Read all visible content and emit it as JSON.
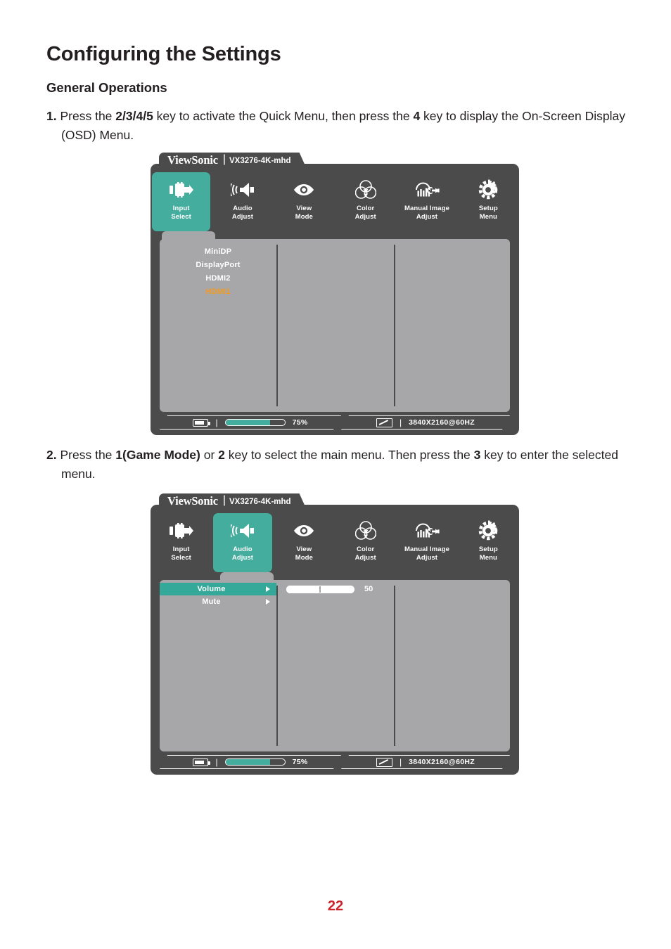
{
  "document": {
    "heading": "Configuring the Settings",
    "subheading": "General Operations",
    "page_number": "22"
  },
  "steps": [
    {
      "number": "1.",
      "parts": [
        {
          "t": "Press the ",
          "b": false
        },
        {
          "t": "2/3/4/5",
          "b": true
        },
        {
          "t": " key to activate the Quick Menu, then press the ",
          "b": false
        },
        {
          "t": "4",
          "b": true
        },
        {
          "t": " key to display the On-Screen Display (OSD) Menu.",
          "b": false
        }
      ]
    },
    {
      "number": "2.",
      "parts": [
        {
          "t": "Press the ",
          "b": false
        },
        {
          "t": "1(Game Mode)",
          "b": true
        },
        {
          "t": " or ",
          "b": false
        },
        {
          "t": "2",
          "b": true
        },
        {
          "t": " key to select the main menu. Then press the ",
          "b": false
        },
        {
          "t": "3",
          "b": true
        },
        {
          "t": " key to enter the selected menu.",
          "b": false
        }
      ]
    }
  ],
  "colors": {
    "accent_teal": "#45ad9e",
    "row_teal": "#34a99a",
    "frame_dark": "#4b4b4b",
    "panel_gray": "#a7a7a9",
    "selected_orange": "#f59a1f",
    "page_number_red": "#cc2229"
  },
  "osd_common": {
    "brand": "ViewSonic",
    "separator": "|",
    "model": "VX3276-4K-mhd",
    "menu_items": [
      {
        "label_line1": "Input",
        "label_line2": "Select",
        "icon": "input-plug-icon"
      },
      {
        "label_line1": "Audio",
        "label_line2": "Adjust",
        "icon": "speaker-icon"
      },
      {
        "label_line1": "View",
        "label_line2": "Mode",
        "icon": "eye-icon"
      },
      {
        "label_line1": "Color",
        "label_line2": "Adjust",
        "icon": "color-circles-icon"
      },
      {
        "label_line1": "Manual Image",
        "label_line2": "Adjust",
        "icon": "image-wrench-icon"
      },
      {
        "label_line1": "Setup",
        "label_line2": "Menu",
        "icon": "gear-icon"
      }
    ],
    "status_bar": {
      "battery_icon": "battery-icon",
      "divider": "|",
      "brightness_percent": "75%",
      "brightness_value": 75,
      "contrast_icon": "contrast-icon",
      "resolution": "3840X2160@60HZ"
    }
  },
  "osd1": {
    "active_index": 0,
    "options": [
      {
        "label": "MiniDP",
        "selected": false
      },
      {
        "label": "DisplayPort",
        "selected": false
      },
      {
        "label": "HDMI2",
        "selected": false
      },
      {
        "label": "HDMI1",
        "selected": true
      }
    ]
  },
  "osd2": {
    "active_index": 1,
    "rows": [
      {
        "label": "Volume",
        "arrow": "right-arrow-icon",
        "highlighted": true
      },
      {
        "label": "Mute",
        "arrow": "right-arrow-icon",
        "highlighted": false
      }
    ],
    "value": {
      "slider_value": 50,
      "slider_label": "50",
      "slider_percent": 50
    }
  }
}
